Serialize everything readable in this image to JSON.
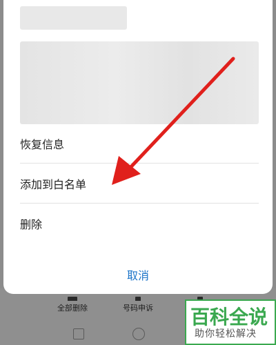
{
  "sheet": {
    "options": [
      {
        "label": "恢复信息"
      },
      {
        "label": "添加到白名单"
      },
      {
        "label": "删除"
      }
    ],
    "cancel_label": "取消"
  },
  "bottom_tools": [
    {
      "label": "全部删除"
    },
    {
      "label": "号码申诉"
    }
  ],
  "watermark": {
    "title": "百科全说",
    "subtitle": "助你轻松解决"
  },
  "annotation": {
    "color": "#e0201c"
  }
}
